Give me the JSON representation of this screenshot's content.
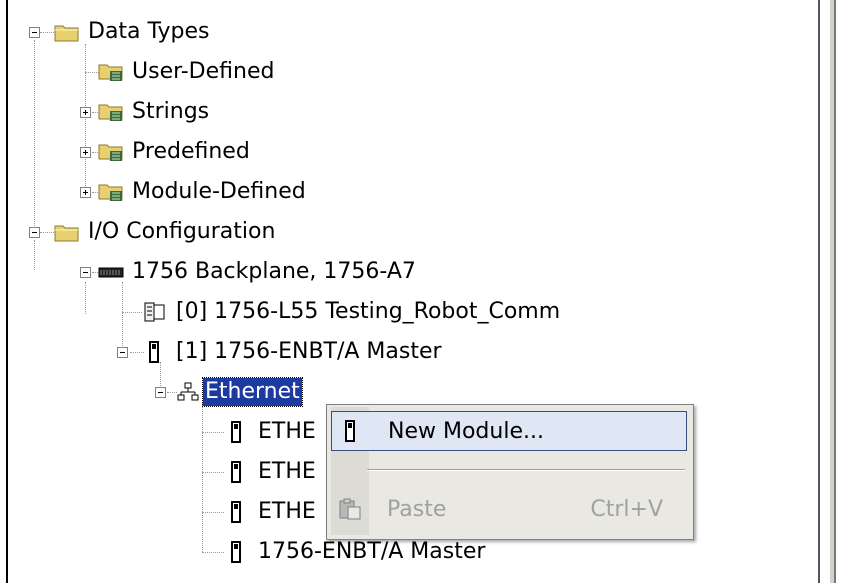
{
  "tree": {
    "data_types": "Data Types",
    "user_defined": "User-Defined",
    "strings": "Strings",
    "predefined": "Predefined",
    "module_defined": "Module-Defined",
    "io_configuration": "I/O Configuration",
    "backplane": "1756 Backplane, 1756-A7",
    "controller": "[0] 1756-L55 Testing_Robot_Comm",
    "enbt_master": "[1] 1756-ENBT/A Master",
    "ethernet": "Ethernet",
    "child_1": "ETHE",
    "child_2": "ETHE",
    "child_3": "ETHE",
    "child_4": "1756-ENBT/A Master"
  },
  "context_menu": {
    "new_module": "New Module...",
    "paste": "Paste",
    "paste_shortcut": "Ctrl+V"
  },
  "colors": {
    "selection": "#1c3aa0",
    "folder": "#e8d070",
    "menu_background": "#e9e8e2",
    "disabled_text": "#a0a0a0"
  }
}
